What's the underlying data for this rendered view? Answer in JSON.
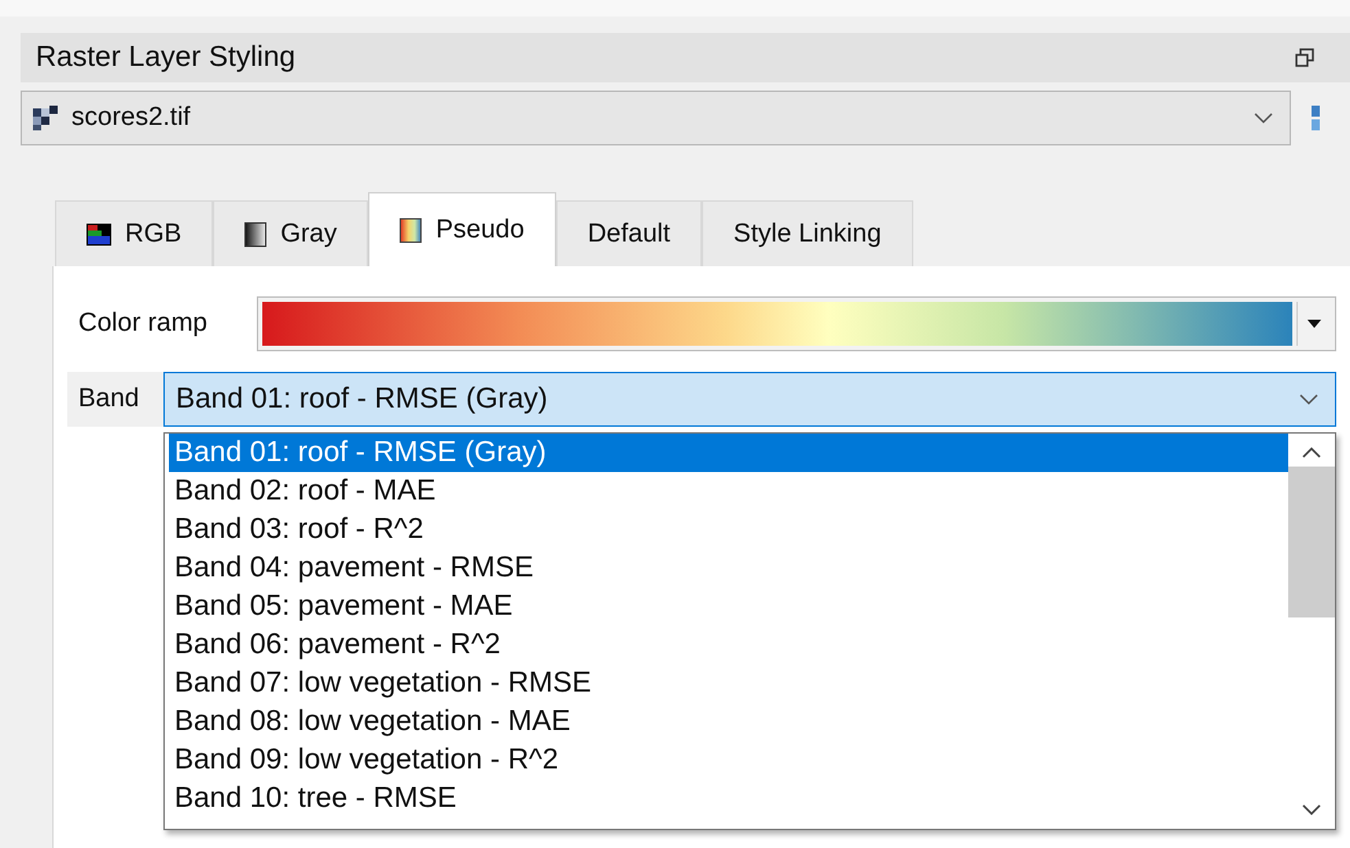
{
  "panel": {
    "title": "Raster Layer Styling"
  },
  "layer_select": {
    "value": "scores2.tif"
  },
  "tabs": [
    {
      "label": "RGB",
      "kind": "rgb",
      "selected": false
    },
    {
      "label": "Gray",
      "kind": "gray",
      "selected": false
    },
    {
      "label": "Pseudo",
      "kind": "pseudo",
      "selected": true
    },
    {
      "label": "Default",
      "kind": "plain",
      "selected": false
    },
    {
      "label": "Style Linking",
      "kind": "plain",
      "selected": false
    }
  ],
  "color_ramp": {
    "label": "Color ramp"
  },
  "band": {
    "label": "Band",
    "value": "Band 01: roof - RMSE (Gray)",
    "expanded": true,
    "options": [
      {
        "label": "Band 01: roof - RMSE (Gray)",
        "selected": true
      },
      {
        "label": "Band 02: roof - MAE",
        "selected": false
      },
      {
        "label": "Band 03: roof - R^2",
        "selected": false
      },
      {
        "label": "Band 04: pavement - RMSE",
        "selected": false
      },
      {
        "label": "Band 05: pavement - MAE",
        "selected": false
      },
      {
        "label": "Band 06: pavement - R^2",
        "selected": false
      },
      {
        "label": "Band 07: low vegetation - RMSE",
        "selected": false
      },
      {
        "label": "Band 08: low vegetation - MAE",
        "selected": false
      },
      {
        "label": "Band 09: low vegetation - R^2",
        "selected": false
      },
      {
        "label": "Band 10: tree - RMSE",
        "selected": false
      }
    ]
  }
}
